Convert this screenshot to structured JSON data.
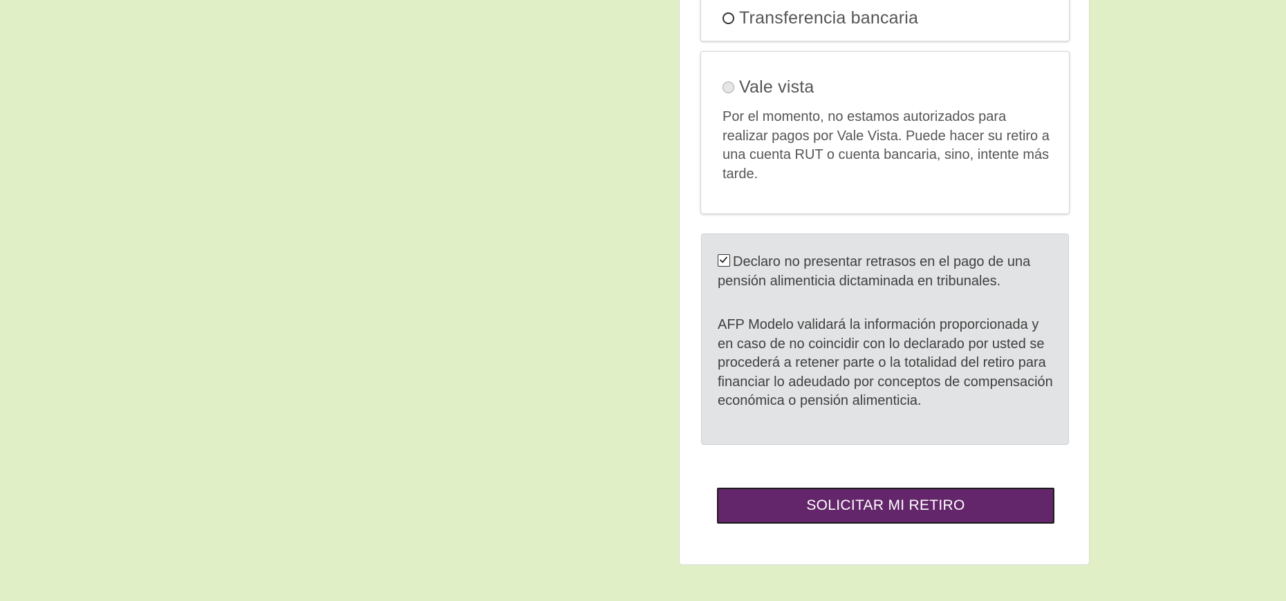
{
  "payment_options": {
    "transfer": {
      "label": "Transferencia bancaria"
    },
    "vale_vista": {
      "label": "Vale vista",
      "description": "Por el momento, no estamos autorizados para realizar pagos por Vale Vista. Puede hacer su retiro a una cuenta RUT o cuenta bancaria, sino, intente más tarde."
    }
  },
  "declaration": {
    "checkbox_label": "Declaro no presentar retrasos en el pago de una pensión alimenticia dictaminada en tribunales.",
    "note": "AFP Modelo validará la información proporcionada y en caso de no coincidir con lo declarado por usted se procederá a retener parte o la totalidad del retiro para financiar lo adeudado por conceptos de compensación económica o pensión alimenticia."
  },
  "submit": {
    "label": "SOLICITAR MI RETIRO"
  },
  "colors": {
    "page_background": "#e1efc6",
    "button_background": "#64266a",
    "declaration_background": "#e2e3e4"
  }
}
